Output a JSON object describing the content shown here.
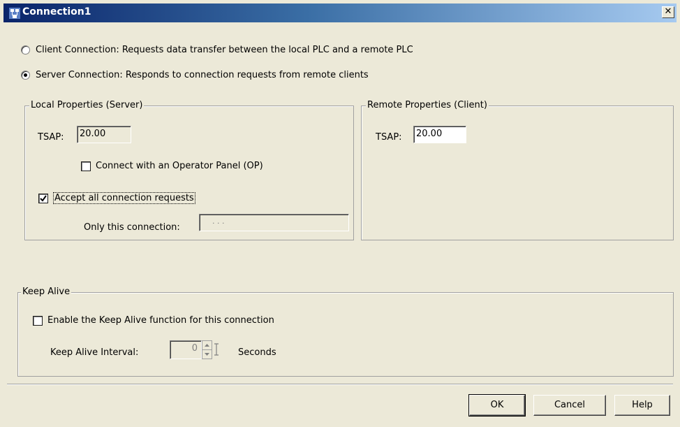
{
  "window": {
    "title": "Connection1",
    "close_label": "✕"
  },
  "connection_type": {
    "client_label": "Client Connection: Requests data transfer between the local PLC and a remote PLC",
    "server_label": "Server Connection: Responds to connection requests from remote clients",
    "selected": "server"
  },
  "local": {
    "group_label": "Local Properties (Server)",
    "tsap_label": "TSAP:",
    "tsap_value": "20.00",
    "op_label": "Connect with an Operator Panel (OP)",
    "op_checked": false,
    "accept_label": "Accept all connection requests",
    "accept_checked": true,
    "only_label": "Only this connection:",
    "only_value": ".   .   ."
  },
  "remote": {
    "group_label": "Remote Properties (Client)",
    "tsap_label": "TSAP:",
    "tsap_value": "20.00"
  },
  "keep_alive": {
    "group_label": "Keep Alive",
    "enable_label": "Enable the Keep Alive function for this connection",
    "enable_checked": false,
    "interval_label": "Keep Alive  Interval:",
    "interval_value": "0",
    "units_label": "Seconds"
  },
  "buttons": {
    "ok": "OK",
    "cancel": "Cancel",
    "help": "Help"
  },
  "colors": {
    "title_start": "#0a246a",
    "title_end": "#a6caf0",
    "face": "#ece9d8"
  }
}
